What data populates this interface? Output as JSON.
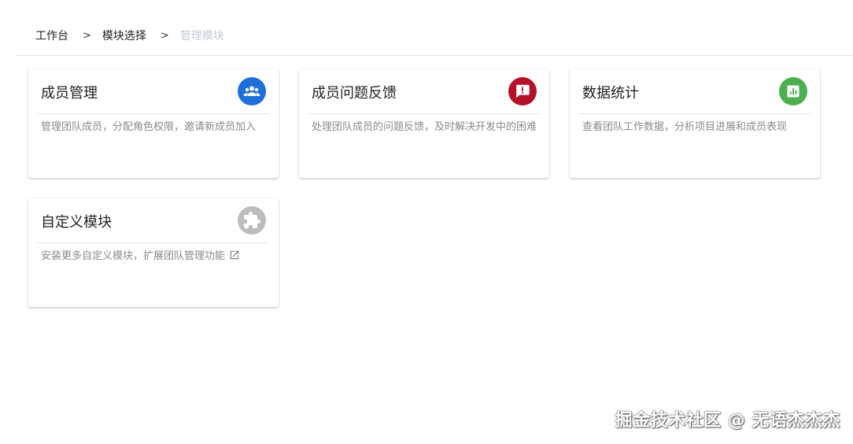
{
  "breadcrumb": {
    "items": [
      "工作台",
      "模块选择",
      "管理模块"
    ],
    "separator": ">"
  },
  "cards": [
    {
      "title": "成员管理",
      "icon": "group-icon",
      "icon_color": "#1e6fd9",
      "description": "管理团队成员，分配角色权限，邀请新成员加入"
    },
    {
      "title": "成员问题反馈",
      "icon": "feedback-icon",
      "icon_color": "#b5102a",
      "description": "处理团队成员的问题反馈，及时解决开发中的困难"
    },
    {
      "title": "数据统计",
      "icon": "chart-icon",
      "icon_color": "#4caf50",
      "description": "查看团队工作数据，分析项目进展和成员表现"
    },
    {
      "title": "自定义模块",
      "icon": "puzzle-icon",
      "icon_color": "#bdbdbd",
      "description": "安装更多自定义模块，扩展团队管理功能",
      "link_icon": "external-link-icon"
    }
  ],
  "watermark": "掘金技术社区 @ 无语杰杰杰"
}
